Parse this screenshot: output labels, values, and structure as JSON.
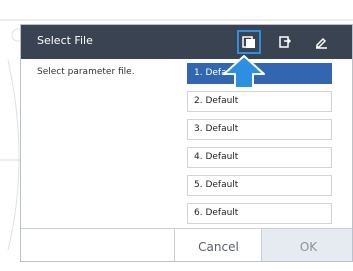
{
  "dialog": {
    "title": "Select File",
    "prompt": "Select parameter file.",
    "toolbar_icons": [
      "file-select-icon",
      "file-transfer-icon",
      "edit-icon"
    ]
  },
  "slots": [
    {
      "label": "1. Default",
      "active": true
    },
    {
      "label": "2. Default",
      "active": false
    },
    {
      "label": "3. Default",
      "active": false
    },
    {
      "label": "4. Default",
      "active": false
    },
    {
      "label": "5. Default",
      "active": false
    },
    {
      "label": "6. Default",
      "active": false
    }
  ],
  "buttons": {
    "cancel": "Cancel",
    "ok": "OK"
  },
  "colors": {
    "titlebar": "#3a4352",
    "highlight": "#2d8fe0",
    "selected_slot": "#3366b0",
    "ok_button_bg": "#e6ebf1"
  }
}
